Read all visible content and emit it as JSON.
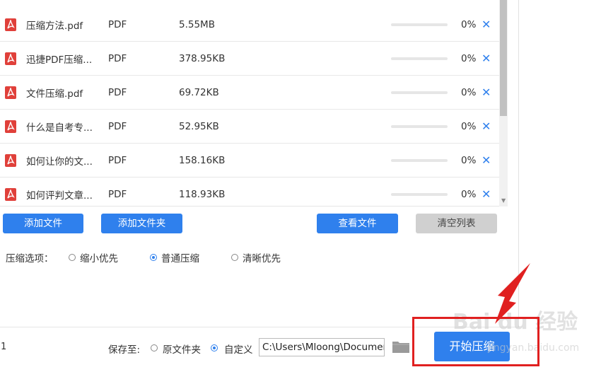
{
  "files": [
    {
      "name": "压缩方法.pdf",
      "type": "PDF",
      "size": "5.55MB",
      "percent": "0%",
      "progress": 0
    },
    {
      "name": "迅捷PDF压缩...",
      "type": "PDF",
      "size": "378.95KB",
      "percent": "0%",
      "progress": 0
    },
    {
      "name": "文件压缩.pdf",
      "type": "PDF",
      "size": "69.72KB",
      "percent": "0%",
      "progress": 0
    },
    {
      "name": "什么是自考专...",
      "type": "PDF",
      "size": "52.95KB",
      "percent": "0%",
      "progress": 0
    },
    {
      "name": "如何让你的文...",
      "type": "PDF",
      "size": "158.16KB",
      "percent": "0%",
      "progress": 0
    },
    {
      "name": "如何评判文章...",
      "type": "PDF",
      "size": "118.93KB",
      "percent": "0%",
      "progress": 0
    }
  ],
  "remove_glyph": "✕",
  "buttons": {
    "add_file": "添加文件",
    "add_folder": "添加文件夹",
    "view_file": "查看文件",
    "clear_list": "清空列表"
  },
  "compress": {
    "label": "压缩选项：",
    "options": [
      "缩小优先",
      "普通压缩",
      "清晰优先"
    ],
    "selected": "普通压缩"
  },
  "footer": {
    "left_text": "1",
    "save_to_label": "保存至:",
    "save_options": [
      "原文件夹",
      "自定义"
    ],
    "save_selected": "自定义",
    "path_value": "C:\\Users\\Mloong\\Documents",
    "start_label": "开始压缩"
  },
  "watermark": {
    "main": "Bai du 经验",
    "sub": "jingyan.baidu.com"
  },
  "colors": {
    "accent": "#2f80ed",
    "pdf_red": "#e0403a",
    "highlight": "#e02020"
  }
}
